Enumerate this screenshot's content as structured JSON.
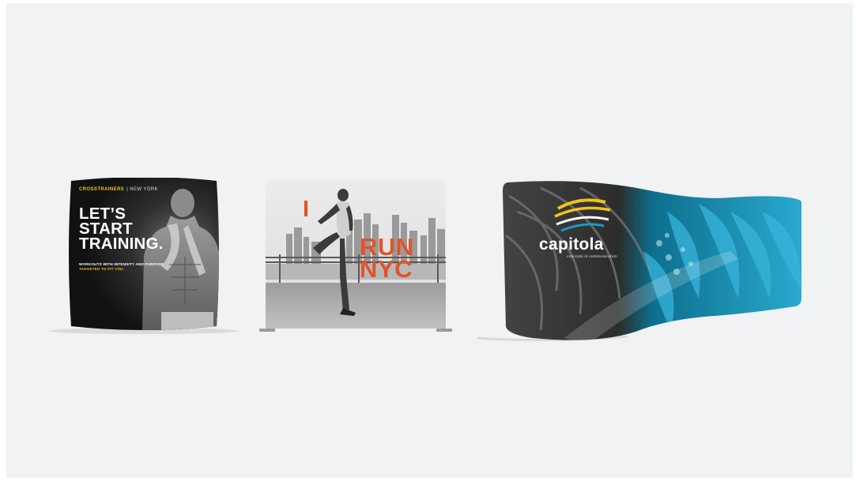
{
  "scene": {
    "background": "#f1f2f4"
  },
  "displays": [
    {
      "brand_strong": "CROSSTRAINERS",
      "brand_sub": "| NEW YORK",
      "headline_lines": [
        "LET’S",
        "START",
        "TRAINING."
      ],
      "tagline_1": "WORKOUTS WITH INTENSITY AND PURPOSE",
      "tagline_2": "TARGETED TO FIT YOU.",
      "accent_color": "#f2c21b"
    },
    {
      "word_1": "I",
      "word_2": "RUN",
      "word_3": "NYC",
      "accent_color": "#e0532b"
    },
    {
      "logo": "capitola",
      "logo_sub": "concepts in communication",
      "accent_color": "#1a9bc0"
    }
  ]
}
